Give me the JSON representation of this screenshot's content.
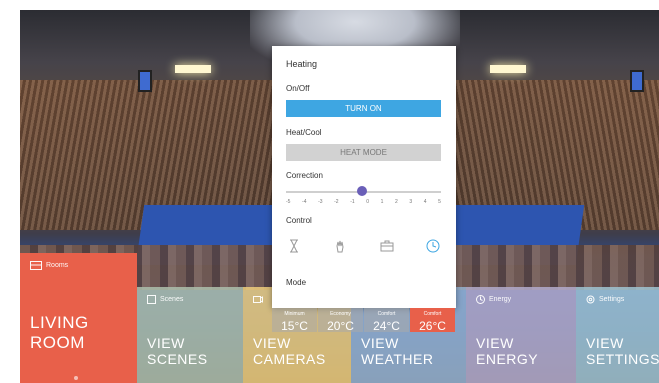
{
  "popup": {
    "title": "Heating",
    "onoff_label": "On/Off",
    "turn_on": "TURN ON",
    "heatcool_label": "Heat/Cool",
    "heat_mode": "HEAT MODE",
    "correction_label": "Correction",
    "correction_value": 0,
    "ticks": [
      "-5",
      "-4",
      "-3",
      "-2",
      "-1",
      "0",
      "1",
      "2",
      "3",
      "4",
      "5"
    ],
    "control_label": "Control",
    "control_icons": [
      "hourglass-icon",
      "hand-icon",
      "briefcase-icon",
      "clock-icon"
    ],
    "mode_label": "Mode",
    "modes": [
      {
        "label": "Minimum",
        "value": "15°C"
      },
      {
        "label": "Economy",
        "value": "20°C"
      },
      {
        "label": "Comfort",
        "value": "24°C"
      },
      {
        "label": "Comfort",
        "value": "26°C",
        "active": true
      }
    ]
  },
  "tiles": {
    "rooms": {
      "small": "Rooms",
      "big_line1": "LIVING",
      "big_line2": "ROOM"
    },
    "scenes": {
      "small": "Scenes",
      "big_line1": "VIEW",
      "big_line2": "SCENES"
    },
    "cameras": {
      "small": "",
      "big_line1": "VIEW",
      "big_line2": "CAMERAS"
    },
    "weather": {
      "small": "",
      "big_line1": "VIEW",
      "big_line2": "WEATHER"
    },
    "energy": {
      "small": "Energy",
      "big_line1": "VIEW",
      "big_line2": "ENERGY"
    },
    "settings": {
      "small": "Settings",
      "big_line1": "VIEW",
      "big_line2": "SETTINGS"
    }
  },
  "colors": {
    "accent": "#3ea6e2",
    "active": "#e8604a",
    "knob": "#6a5fb8"
  }
}
